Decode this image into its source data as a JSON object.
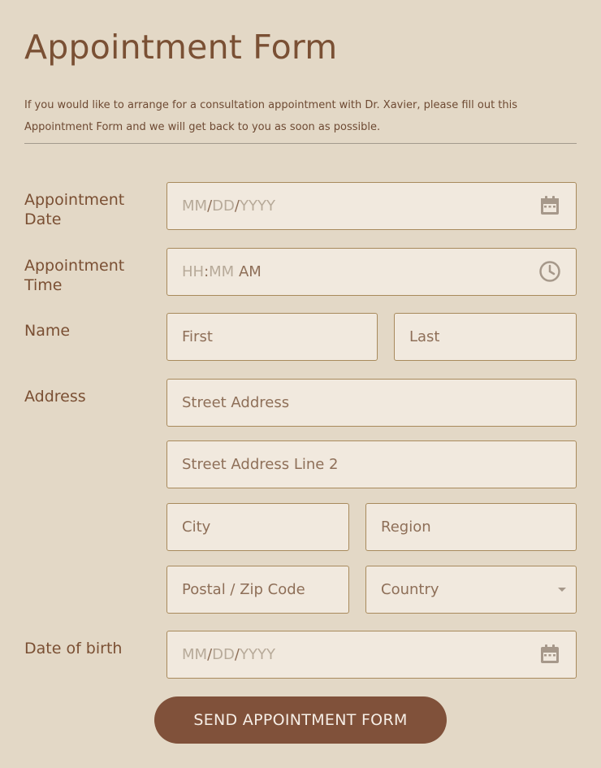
{
  "form": {
    "title": "Appointment Form",
    "description": "If you would like to arrange for a consultation appointment with Dr. Xavier, please fill out this Appointment Form and we will get back to you as soon as possible."
  },
  "appointment_date": {
    "label": "Appointment Date",
    "mm": "MM",
    "dd": "DD",
    "yyyy": "YYYY",
    "sep": "/",
    "icon": "calendar-icon"
  },
  "appointment_time": {
    "label": "Appointment Time",
    "hh": "HH",
    "colon": ":",
    "mm": "MM",
    "ampm": "AM",
    "icon": "clock-icon"
  },
  "name": {
    "label": "Name",
    "first_placeholder": "First",
    "last_placeholder": "Last"
  },
  "address": {
    "label": "Address",
    "street_placeholder": "Street Address",
    "street2_placeholder": "Street Address Line 2",
    "city_placeholder": "City",
    "region_placeholder": "Region",
    "postal_placeholder": "Postal / Zip Code",
    "country_placeholder": "Country"
  },
  "dob": {
    "label": "Date of birth",
    "mm": "MM",
    "dd": "DD",
    "yyyy": "YYYY",
    "sep": "/",
    "icon": "calendar-icon"
  },
  "submit": {
    "label": "SEND APPOINTMENT FORM"
  },
  "colors": {
    "background": "#e3d8c6",
    "field_bg": "#f1e9de",
    "field_border": "#a88a5c",
    "label": "#7a4f33",
    "button": "#80513a"
  }
}
